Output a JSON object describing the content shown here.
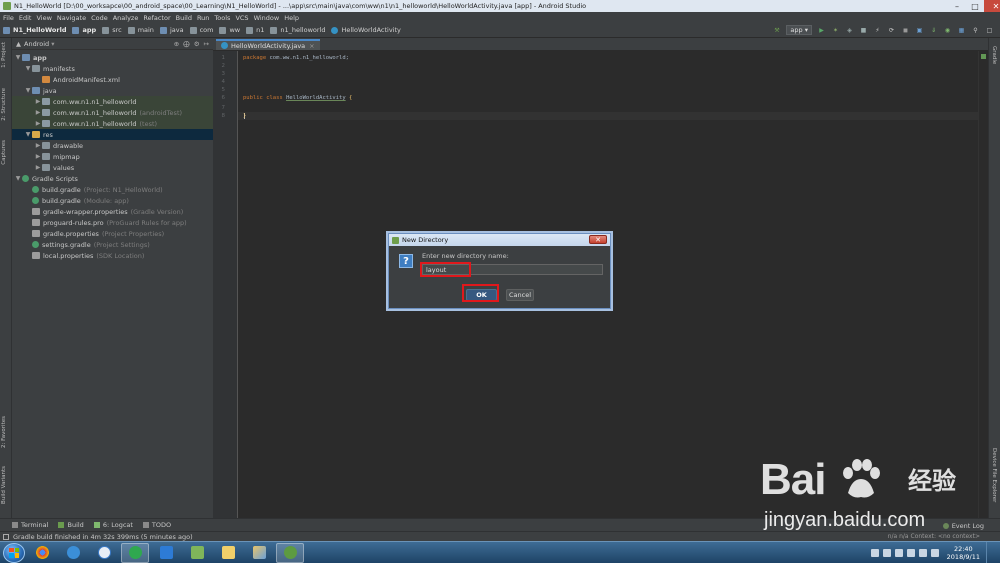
{
  "window": {
    "title": "N1_HelloWorld [D:\\00_worksapce\\00_android_space\\00_Learning\\N1_HelloWorld] - ...\\app\\src\\main\\java\\com\\ww\\n1\\n1_helloworld\\HelloWorldActivity.java [app] - Android Studio",
    "minimize": "–",
    "maximize": "□",
    "close": "✕"
  },
  "menu": [
    "File",
    "Edit",
    "View",
    "Navigate",
    "Code",
    "Analyze",
    "Refactor",
    "Build",
    "Run",
    "Tools",
    "VCS",
    "Window",
    "Help"
  ],
  "breadcrumbs": [
    "N1_HelloWorld",
    "app",
    "src",
    "main",
    "java",
    "com",
    "ww",
    "n1",
    "n1_helloworld",
    "HelloWorldActivity"
  ],
  "toolbar": {
    "run_config": "app"
  },
  "project_panel": {
    "view_mode": "Android",
    "tree": [
      {
        "label": "app",
        "hint": "",
        "icon": "module-folder-icon"
      },
      {
        "label": "manifests",
        "hint": "",
        "icon": "folder-icon"
      },
      {
        "label": "AndroidManifest.xml",
        "hint": "",
        "icon": "xml-file-icon"
      },
      {
        "label": "java",
        "hint": "",
        "icon": "source-folder-icon"
      },
      {
        "label": "com.ww.n1.n1_helloworld",
        "hint": "",
        "icon": "package-icon"
      },
      {
        "label": "com.ww.n1.n1_helloworld",
        "hint": "(androidTest)",
        "icon": "package-icon"
      },
      {
        "label": "com.ww.n1.n1_helloworld",
        "hint": "(test)",
        "icon": "package-icon"
      },
      {
        "label": "res",
        "hint": "",
        "icon": "resource-folder-icon"
      },
      {
        "label": "drawable",
        "hint": "",
        "icon": "folder-icon"
      },
      {
        "label": "mipmap",
        "hint": "",
        "icon": "folder-icon"
      },
      {
        "label": "values",
        "hint": "",
        "icon": "folder-icon"
      },
      {
        "label": "Gradle Scripts",
        "hint": "",
        "icon": "gradle-icon"
      },
      {
        "label": "build.gradle",
        "hint": "(Project: N1_HelloWorld)",
        "icon": "gradle-icon"
      },
      {
        "label": "build.gradle",
        "hint": "(Module: app)",
        "icon": "gradle-icon"
      },
      {
        "label": "gradle-wrapper.properties",
        "hint": "(Gradle Version)",
        "icon": "properties-icon"
      },
      {
        "label": "proguard-rules.pro",
        "hint": "(ProGuard Rules for app)",
        "icon": "properties-icon"
      },
      {
        "label": "gradle.properties",
        "hint": "(Project Properties)",
        "icon": "properties-icon"
      },
      {
        "label": "settings.gradle",
        "hint": "(Project Settings)",
        "icon": "gradle-icon"
      },
      {
        "label": "local.properties",
        "hint": "(SDK Location)",
        "icon": "properties-icon"
      }
    ]
  },
  "side_tabs": {
    "left": [
      "1: Project",
      "2: Structure",
      "Captures",
      "2: Favorites",
      "Build Variants"
    ],
    "right": [
      "Gradle",
      "Device File Explorer"
    ]
  },
  "editor": {
    "tab": "HelloWorldActivity.java",
    "line_numbers": [
      "1",
      "2",
      "3",
      "4",
      "5",
      "6",
      "7",
      "8"
    ],
    "lines": {
      "package_kw": "package",
      "package_name": "com.ww.n1.n1_helloworld;",
      "public_kw": "public",
      "class_kw": "class",
      "class_name": "HelloWorldActivity",
      "open_brace": "{",
      "close_brace": "}"
    }
  },
  "bottom_tabs": [
    "Terminal",
    "Build",
    "6: Logcat",
    "TODO"
  ],
  "event_log": "Event Log",
  "status": {
    "message": "Gradle build finished in 4m 32s 399ms (5 minutes ago)",
    "right": "n/a   n/a   Context: <no context>"
  },
  "taskbar": {
    "time": "22:40",
    "date": "2018/9/11"
  },
  "dialog": {
    "title": "New Directory",
    "close": "✕",
    "prompt": "Enter new directory name:",
    "value": "layout",
    "ok": "OK",
    "cancel": "Cancel"
  },
  "watermark": {
    "brand_left": "Bai",
    "brand_right": "经验",
    "url": "jingyan.baidu.com"
  },
  "colors": {
    "ide_bg": "#2b2b2b",
    "panel_bg": "#3c3f41",
    "highlight_red": "#e0181c",
    "keyword": "#cc7832"
  }
}
